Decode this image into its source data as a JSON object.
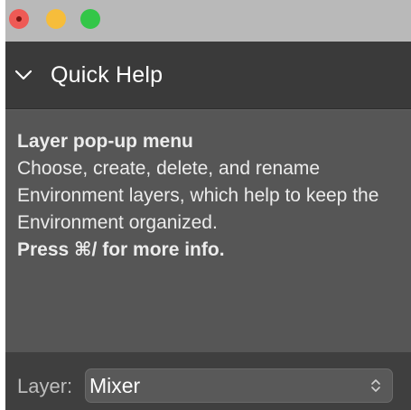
{
  "window": {
    "controls": {
      "close": "close-button",
      "minimize": "minimize-button",
      "zoom": "zoom-button"
    }
  },
  "panel": {
    "title": "Quick Help",
    "icon": "chevron-down-icon"
  },
  "help": {
    "title": "Layer pop-up menu",
    "body": "Choose, create, delete, and rename Environment layers, which help to keep the Environment organized.",
    "shortcut": "Press ⌘/ for more info."
  },
  "footer": {
    "label": "Layer:",
    "selected": "Mixer",
    "icon": "up-down-chevrons-icon"
  },
  "colors": {
    "close": "#ee5a55",
    "minimize": "#f6bd3b",
    "zoom": "#33c648"
  }
}
